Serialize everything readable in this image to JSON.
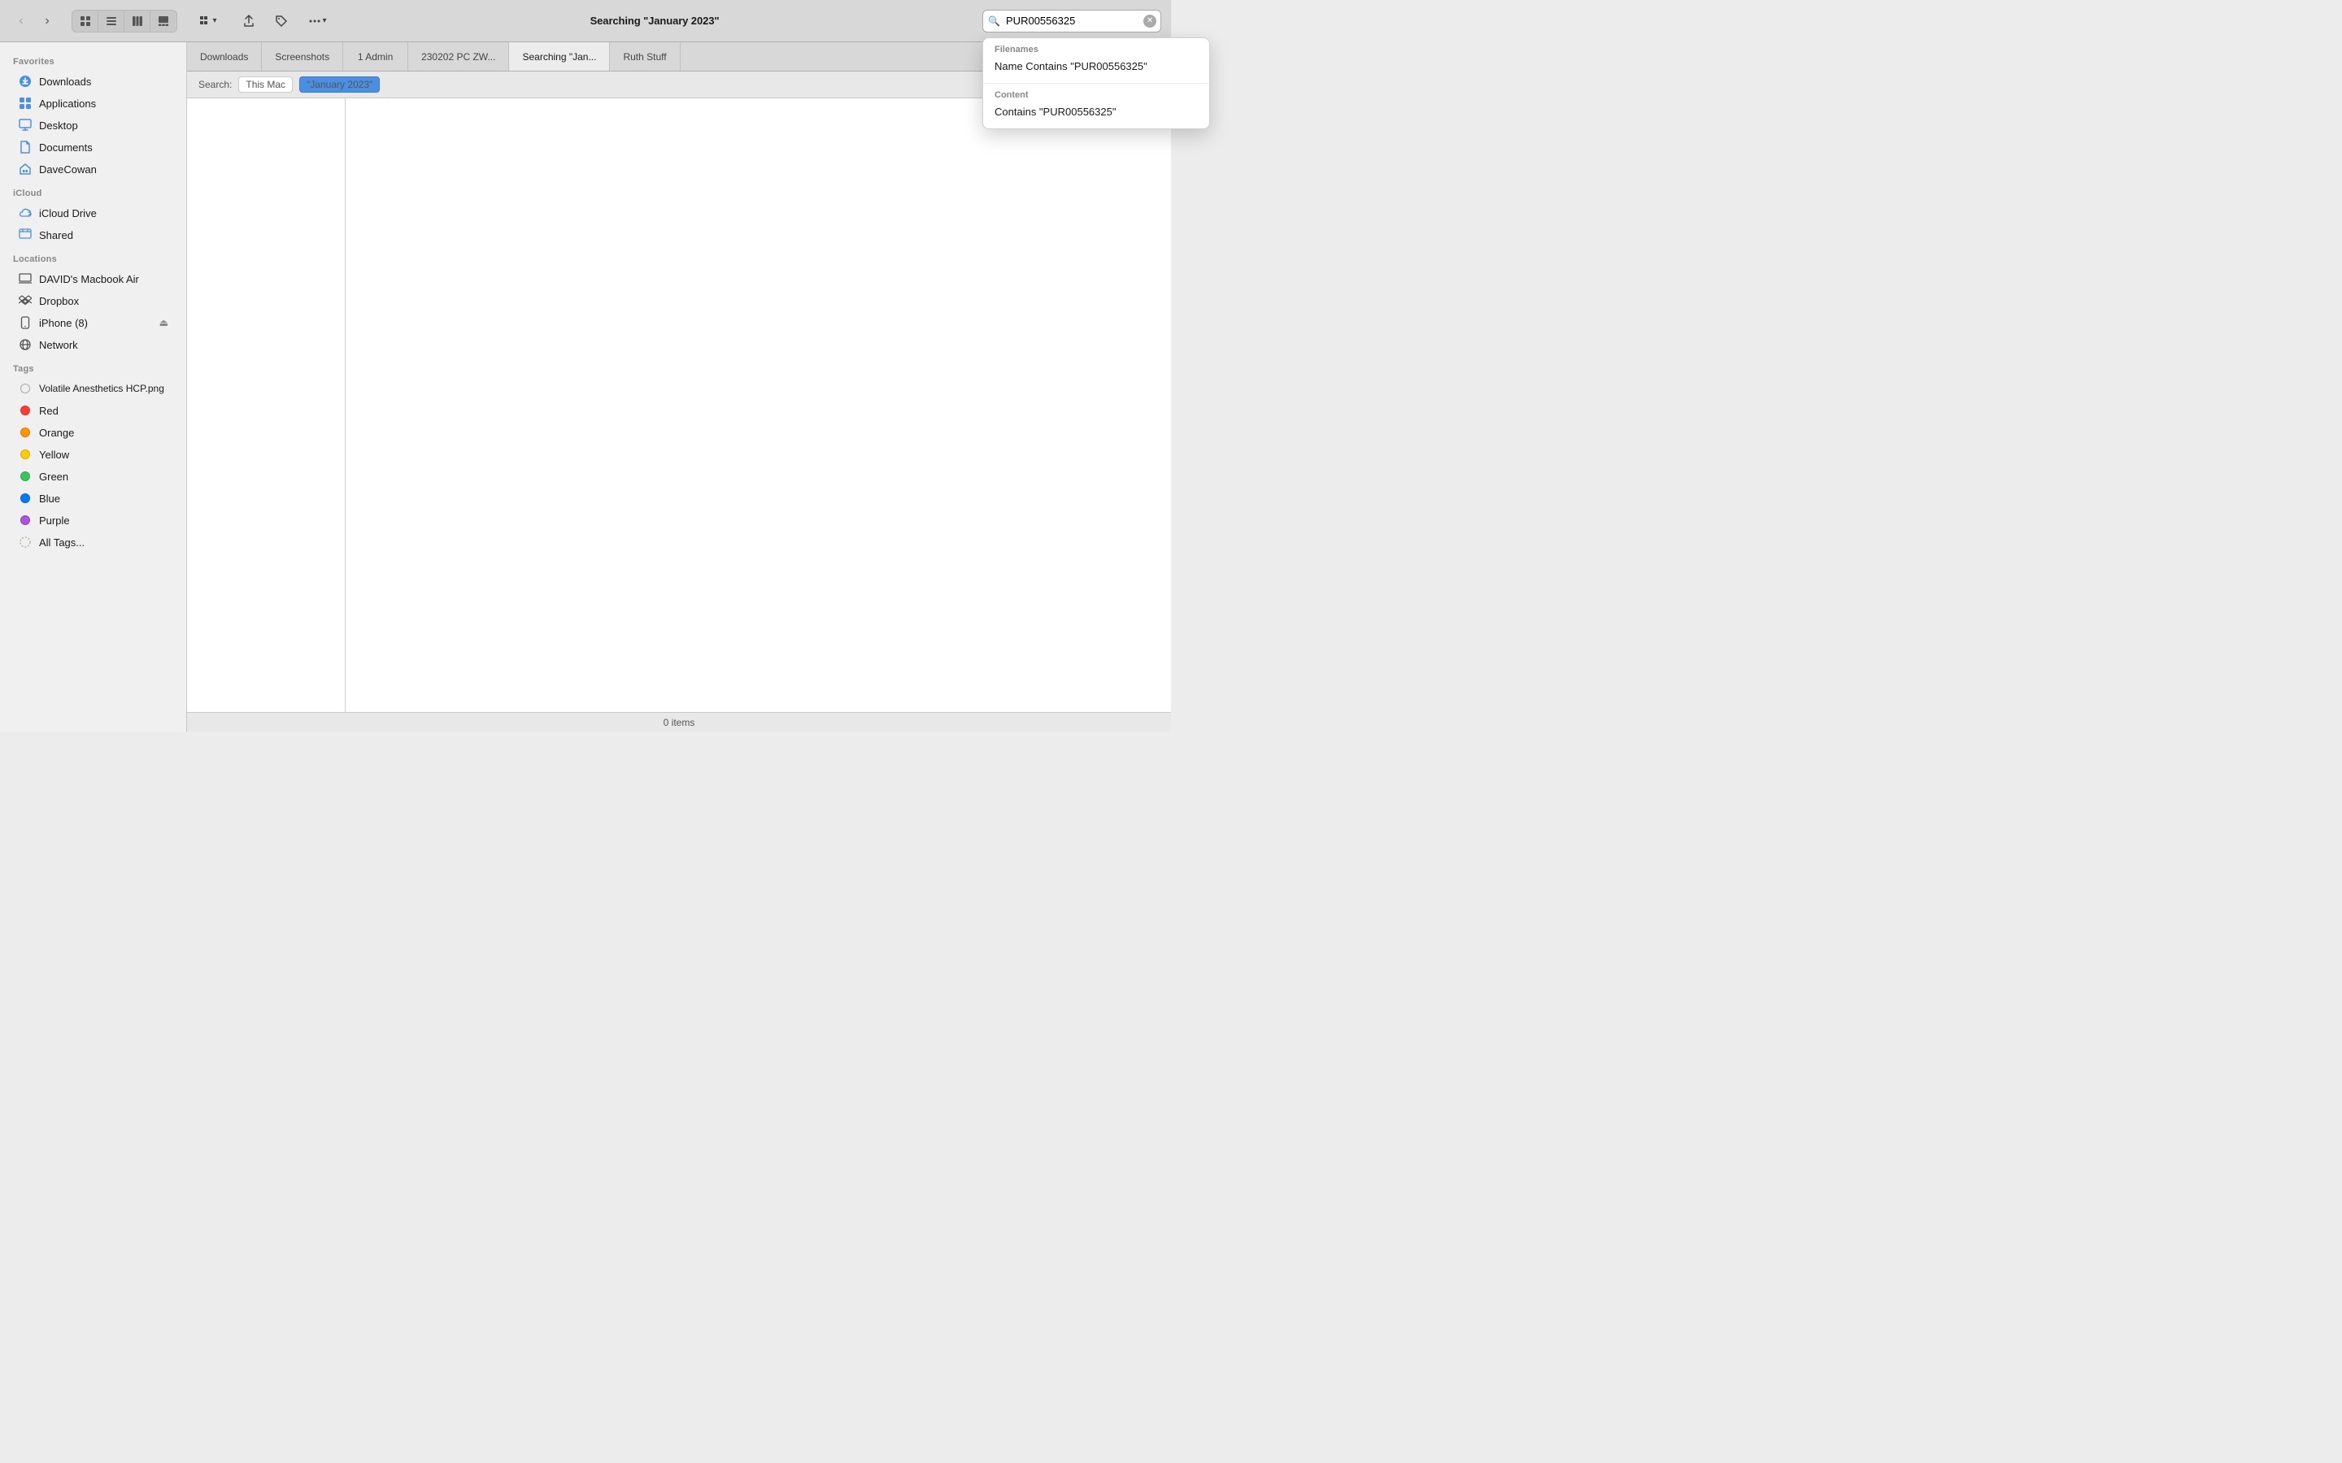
{
  "toolbar": {
    "back_label": "‹",
    "forward_label": "›",
    "title": "Searching \"January 2023\"",
    "view_icon_grid": "⊞",
    "view_icon_list": "≡",
    "view_icon_columns": "⊟",
    "view_icon_gallery": "⊠",
    "action_share": "↑",
    "action_tag": "🏷",
    "action_more": "···",
    "search_placeholder": "PUR00556325",
    "search_value": "PUR00556325"
  },
  "dropdown": {
    "filenames_label": "Filenames",
    "filenames_item": "Name Contains \"PUR00556325\"",
    "content_label": "Content",
    "content_item": "Contains \"PUR00556325\""
  },
  "tabs": [
    {
      "label": "Downloads",
      "active": false
    },
    {
      "label": "Screenshots",
      "active": false
    },
    {
      "label": "1 Admin",
      "active": false
    },
    {
      "label": "230202 PC ZW...",
      "active": false
    },
    {
      "label": "Searching \"Jan...",
      "active": true
    },
    {
      "label": "Ruth Stuff",
      "active": false
    }
  ],
  "search_context": {
    "label": "Search:",
    "this_mac": "This Mac",
    "query": "\"January 2023\""
  },
  "sidebar": {
    "favorites_label": "Favorites",
    "icloud_label": "iCloud",
    "locations_label": "Locations",
    "tags_label": "Tags",
    "favorites": [
      {
        "id": "downloads",
        "label": "Downloads",
        "icon": "⬇"
      },
      {
        "id": "applications",
        "label": "Applications",
        "icon": "📱"
      },
      {
        "id": "desktop",
        "label": "Desktop",
        "icon": "🖥"
      },
      {
        "id": "documents",
        "label": "Documents",
        "icon": "📄"
      },
      {
        "id": "davecowan",
        "label": "DaveCowan",
        "icon": "🏠"
      }
    ],
    "icloud": [
      {
        "id": "icloud-drive",
        "label": "iCloud Drive",
        "icon": "☁"
      },
      {
        "id": "shared",
        "label": "Shared",
        "icon": "📁"
      }
    ],
    "locations": [
      {
        "id": "davids-macbook",
        "label": "DAVID's Macbook Air",
        "icon": "💻"
      },
      {
        "id": "dropbox",
        "label": "Dropbox",
        "icon": "📦"
      },
      {
        "id": "iphone",
        "label": "iPhone (8)",
        "icon": "📱",
        "badge": "⏏"
      },
      {
        "id": "network",
        "label": "Network",
        "icon": "🌐"
      }
    ],
    "tags": [
      {
        "id": "volatile",
        "label": "Volatile Anesthetics HCP.png",
        "color": ""
      },
      {
        "id": "red",
        "label": "Red",
        "color": "#ff3b30"
      },
      {
        "id": "orange",
        "label": "Orange",
        "color": "#ff9500"
      },
      {
        "id": "yellow",
        "label": "Yellow",
        "color": "#ffcc00"
      },
      {
        "id": "green",
        "label": "Green",
        "color": "#34c759"
      },
      {
        "id": "blue",
        "label": "Blue",
        "color": "#007aff"
      },
      {
        "id": "purple",
        "label": "Purple",
        "color": "#af52de"
      },
      {
        "id": "all-tags",
        "label": "All Tags...",
        "color": ""
      }
    ]
  },
  "status": {
    "items_count": "0 items"
  }
}
